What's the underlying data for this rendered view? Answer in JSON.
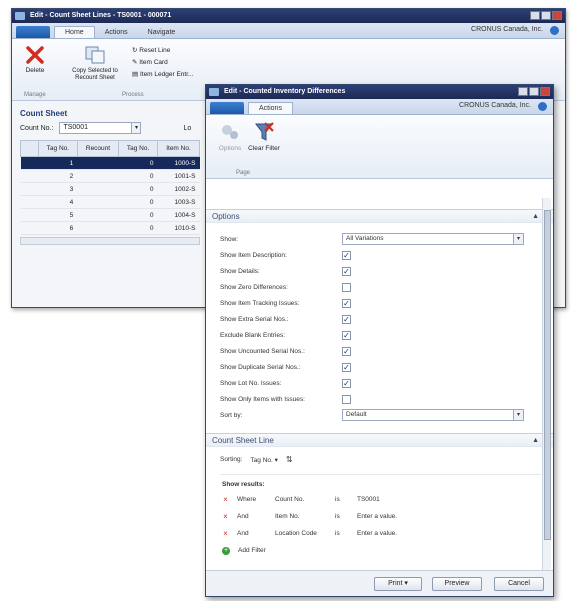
{
  "bg_window": {
    "title": "Edit - Count Sheet Lines - TS0001 - 000071",
    "tabs": [
      "Home",
      "Actions",
      "Navigate"
    ],
    "company": "CRONUS Canada, Inc.",
    "ribbon": {
      "delete_label": "Delete",
      "copy_label": "Copy Selected to Recount Sheet",
      "reset_line": "Reset Line",
      "item_card": "Item Card",
      "item_ledger": "Item Ledger Entr...",
      "group1": "Manage",
      "group2": "Process"
    },
    "sheet_title": "Count Sheet",
    "count_no_label": "Count No.:",
    "count_no_value": "TS0001",
    "lo_label": "Lo",
    "grid_headers": [
      "Tag No.",
      "Recount",
      "Tag No.",
      "Item No."
    ],
    "grid_rows": [
      {
        "tag": "1",
        "recount": "0",
        "item": "1000-S"
      },
      {
        "tag": "2",
        "recount": "0",
        "item": "1001-S"
      },
      {
        "tag": "3",
        "recount": "0",
        "item": "1002-S"
      },
      {
        "tag": "4",
        "recount": "0",
        "item": "1003-S"
      },
      {
        "tag": "5",
        "recount": "0",
        "item": "1004-S"
      },
      {
        "tag": "6",
        "recount": "0",
        "item": "1010-S"
      }
    ]
  },
  "dialog": {
    "title": "Edit - Counted Inventory Differences",
    "tab": "Actions",
    "company": "CRONUS Canada, Inc.",
    "ribbon": {
      "options_label": "Options",
      "clear_filter_label": "Clear Filter",
      "group": "Page"
    },
    "options_header": "Options",
    "show_label": "Show:",
    "show_value": "All Variations",
    "checkboxes": [
      {
        "label": "Show Item Description:",
        "checked": true
      },
      {
        "label": "Show Details:",
        "checked": true
      },
      {
        "label": "Show Zero Differences:",
        "checked": false
      },
      {
        "label": "Show Item Tracking Issues:",
        "checked": true
      },
      {
        "label": "Show Extra Serial Nos.:",
        "checked": true
      },
      {
        "label": "Exclude Blank Entries:",
        "checked": true
      },
      {
        "label": "Show Uncounted Serial Nos.:",
        "checked": true
      },
      {
        "label": "Show Duplicate Serial Nos.:",
        "checked": true
      },
      {
        "label": "Show Lot No. Issues:",
        "checked": true
      },
      {
        "label": "Show Only Items with Issues:",
        "checked": false
      }
    ],
    "sort_label": "Sort by:",
    "sort_value": "Default",
    "count_line_header": "Count Sheet Line",
    "sorting_label": "Sorting:",
    "sorting_value": "Tag No.",
    "show_results_label": "Show results:",
    "filters": [
      {
        "prefix": "Where",
        "field": "Count No.",
        "op": "is",
        "value": "TS0001"
      },
      {
        "prefix": "And",
        "field": "Item No.",
        "op": "is",
        "value": "Enter a value."
      },
      {
        "prefix": "And",
        "field": "Location Code",
        "op": "is",
        "value": "Enter a value."
      }
    ],
    "add_filter": "Add Filter",
    "buttons": {
      "print": "Print",
      "preview": "Preview",
      "cancel": "Cancel"
    }
  }
}
